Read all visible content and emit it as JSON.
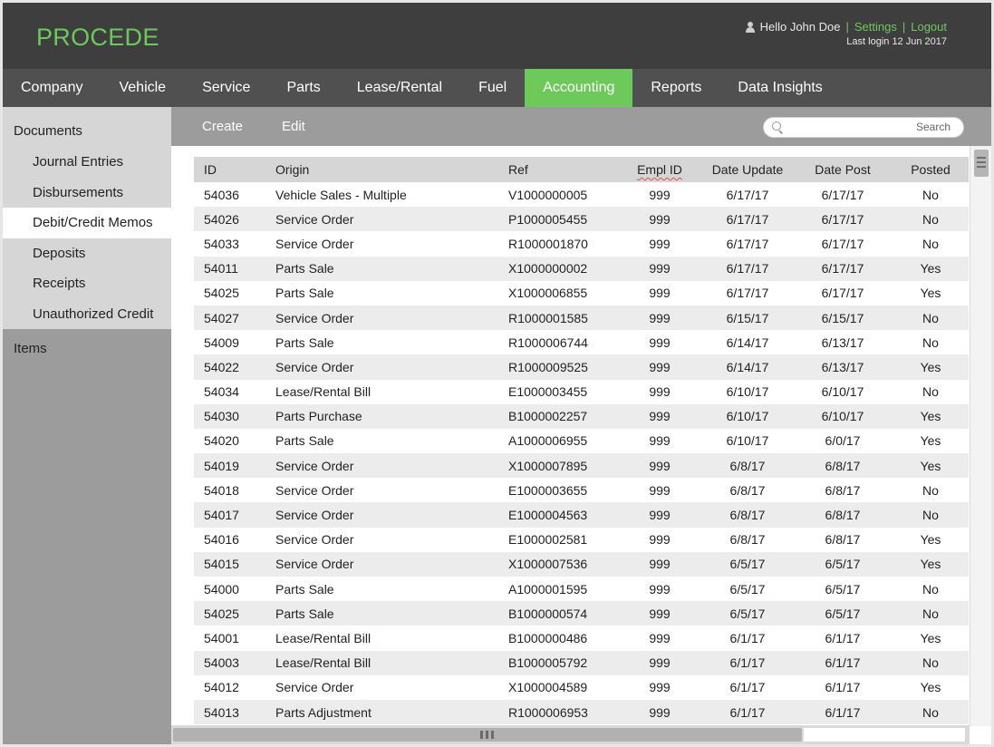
{
  "brand": {
    "logo": "PROCEDE"
  },
  "user": {
    "greeting": "Hello John Doe",
    "settings_label": "Settings",
    "logout_label": "Logout",
    "separator": "|",
    "last_login": "Last login 12 Jun 2017"
  },
  "nav": {
    "items": [
      {
        "label": "Company"
      },
      {
        "label": "Vehicle"
      },
      {
        "label": "Service"
      },
      {
        "label": "Parts"
      },
      {
        "label": "Lease/Rental"
      },
      {
        "label": "Fuel"
      },
      {
        "label": "Accounting",
        "active": true
      },
      {
        "label": "Reports"
      },
      {
        "label": "Data Insights"
      }
    ]
  },
  "sidebar": {
    "documents_label": "Documents",
    "items": [
      {
        "label": "Journal Entries"
      },
      {
        "label": "Disbursements"
      },
      {
        "label": "Debit/Credit Memos",
        "active": true
      },
      {
        "label": "Deposits"
      },
      {
        "label": "Receipts"
      },
      {
        "label": "Unauthorized Credit"
      }
    ],
    "items_label": "Items"
  },
  "toolbar": {
    "create_label": "Create",
    "edit_label": "Edit",
    "search_label": "Search",
    "search_value": ""
  },
  "table": {
    "columns": [
      "ID",
      "Origin",
      "Ref",
      "Empl ID",
      "Date Update",
      "Date Post",
      "Posted"
    ],
    "rows": [
      [
        "54036",
        "Vehicle Sales - Multiple",
        "V1000000005",
        "999",
        "6/17/17",
        "6/17/17",
        "No"
      ],
      [
        "54026",
        "Service Order",
        "P1000005455",
        "999",
        "6/17/17",
        "6/17/17",
        "No"
      ],
      [
        "54033",
        "Service Order",
        "R1000001870",
        "999",
        "6/17/17",
        "6/17/17",
        "No"
      ],
      [
        "54011",
        "Parts Sale",
        "X1000000002",
        "999",
        "6/17/17",
        "6/17/17",
        "Yes"
      ],
      [
        "54025",
        "Parts Sale",
        "X1000006855",
        "999",
        "6/17/17",
        "6/17/17",
        "Yes"
      ],
      [
        "54027",
        "Service Order",
        "R1000001585",
        "999",
        "6/15/17",
        "6/15/17",
        "No"
      ],
      [
        "54009",
        "Parts Sale",
        "R1000006744",
        "999",
        "6/14/17",
        "6/13/17",
        "No"
      ],
      [
        "54022",
        "Service Order",
        "R1000009525",
        "999",
        "6/14/17",
        "6/13/17",
        "Yes"
      ],
      [
        "54034",
        "Lease/Rental Bill",
        "E1000003455",
        "999",
        "6/10/17",
        "6/10/17",
        "No"
      ],
      [
        "54030",
        "Parts Purchase",
        "B1000002257",
        "999",
        "6/10/17",
        "6/10/17",
        "Yes"
      ],
      [
        "54020",
        "Parts Sale",
        "A1000006955",
        "999",
        "6/10/17",
        "6/0/17",
        "Yes"
      ],
      [
        "54019",
        "Service Order",
        "X1000007895",
        "999",
        "6/8/17",
        "6/8/17",
        "Yes"
      ],
      [
        "54018",
        "Service Order",
        "E1000003655",
        "999",
        "6/8/17",
        "6/8/17",
        "No"
      ],
      [
        "54017",
        "Service Order",
        "E1000004563",
        "999",
        "6/8/17",
        "6/8/17",
        "No"
      ],
      [
        "54016",
        "Service Order",
        "E1000002581",
        "999",
        "6/8/17",
        "6/8/17",
        "Yes"
      ],
      [
        "54015",
        "Service Order",
        "X1000007536",
        "999",
        "6/5/17",
        "6/5/17",
        "Yes"
      ],
      [
        "54000",
        "Parts Sale",
        "A1000001595",
        "999",
        "6/5/17",
        "6/5/17",
        "No"
      ],
      [
        "54025",
        "Parts Sale",
        "B1000000574",
        "999",
        "6/5/17",
        "6/5/17",
        "No"
      ],
      [
        "54001",
        "Lease/Rental Bill",
        "B1000000486",
        "999",
        "6/1/17",
        "6/1/17",
        "Yes"
      ],
      [
        "54003",
        "Lease/Rental Bill",
        "B1000005792",
        "999",
        "6/1/17",
        "6/1/17",
        "No"
      ],
      [
        "54012",
        "Service Order",
        "X1000004589",
        "999",
        "6/1/17",
        "6/1/17",
        "Yes"
      ],
      [
        "54013",
        "Parts Adjustment",
        "R1000006953",
        "999",
        "6/1/17",
        "6/1/17",
        "No"
      ]
    ]
  },
  "colors": {
    "accent": "#6cc95a",
    "header_bg": "#3e3e3e",
    "nav_bg": "#505050",
    "sidebar_bg": "#9c9c9c",
    "sidebar_docs_bg": "#d6d6d6"
  }
}
